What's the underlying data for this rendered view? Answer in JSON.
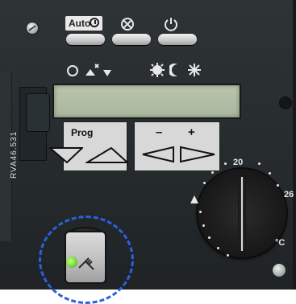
{
  "top": {
    "auto_label": "Auto",
    "fan_icon": "fan-off-icon",
    "power_icon": "power-icon"
  },
  "status_icons": {
    "left": [
      "circle-icon",
      "frost-arrow-icon",
      "down-arrow-icon"
    ],
    "right": [
      "sun-clock-icon",
      "moon-icon",
      "snowflake-icon"
    ]
  },
  "keys": {
    "prog_label": "Prog",
    "minus_label": "–",
    "plus_label": "+"
  },
  "dial": {
    "min_label": "20",
    "max_label": "26",
    "unit_label": "°C"
  },
  "side_text": "RVA46.531"
}
